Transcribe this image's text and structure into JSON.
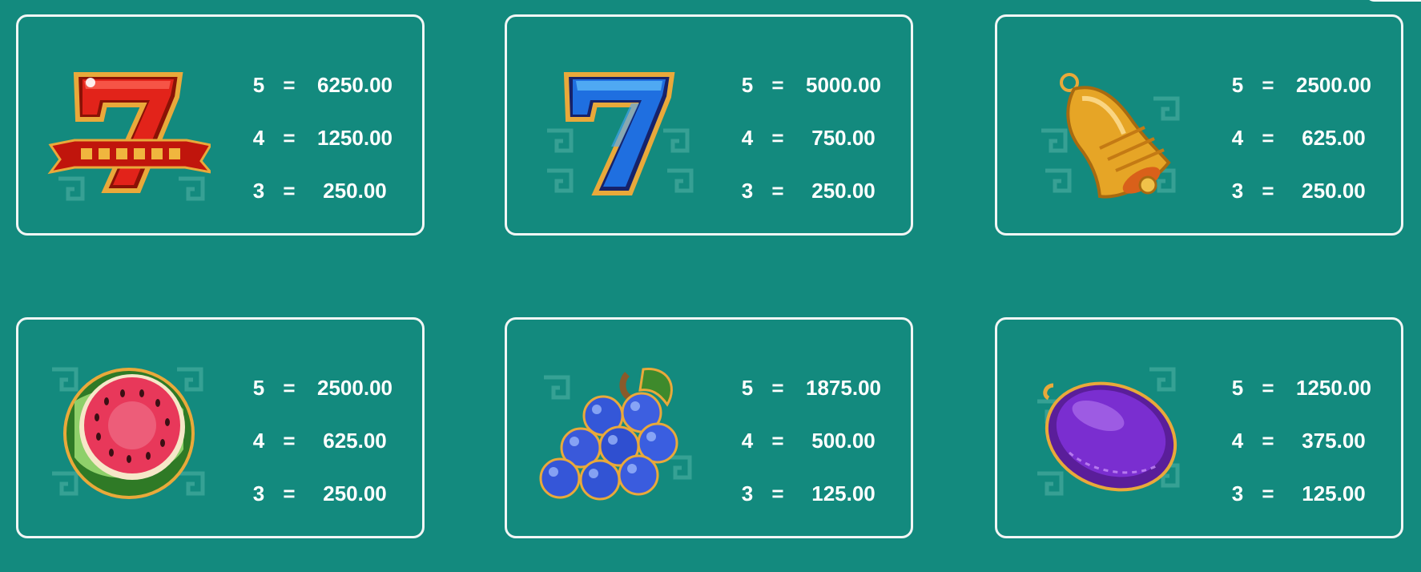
{
  "colors": {
    "background": "#138a7e",
    "border": "#f2f6f5",
    "text": "#ffffff"
  },
  "paytable": [
    {
      "symbol": "red-seven-icon",
      "rows": [
        {
          "count": "5",
          "eq": "=",
          "value": "6250.00"
        },
        {
          "count": "4",
          "eq": "=",
          "value": "1250.00"
        },
        {
          "count": "3",
          "eq": "=",
          "value": "250.00"
        }
      ]
    },
    {
      "symbol": "blue-seven-icon",
      "rows": [
        {
          "count": "5",
          "eq": "=",
          "value": "5000.00"
        },
        {
          "count": "4",
          "eq": "=",
          "value": "750.00"
        },
        {
          "count": "3",
          "eq": "=",
          "value": "250.00"
        }
      ]
    },
    {
      "symbol": "bell-icon",
      "rows": [
        {
          "count": "5",
          "eq": "=",
          "value": "2500.00"
        },
        {
          "count": "4",
          "eq": "=",
          "value": "625.00"
        },
        {
          "count": "3",
          "eq": "=",
          "value": "250.00"
        }
      ]
    },
    {
      "symbol": "watermelon-icon",
      "rows": [
        {
          "count": "5",
          "eq": "=",
          "value": "2500.00"
        },
        {
          "count": "4",
          "eq": "=",
          "value": "625.00"
        },
        {
          "count": "3",
          "eq": "=",
          "value": "250.00"
        }
      ]
    },
    {
      "symbol": "blueberries-icon",
      "rows": [
        {
          "count": "5",
          "eq": "=",
          "value": "1875.00"
        },
        {
          "count": "4",
          "eq": "=",
          "value": "500.00"
        },
        {
          "count": "3",
          "eq": "=",
          "value": "125.00"
        }
      ]
    },
    {
      "symbol": "plum-icon",
      "rows": [
        {
          "count": "5",
          "eq": "=",
          "value": "1250.00"
        },
        {
          "count": "4",
          "eq": "=",
          "value": "375.00"
        },
        {
          "count": "3",
          "eq": "=",
          "value": "125.00"
        }
      ]
    }
  ]
}
